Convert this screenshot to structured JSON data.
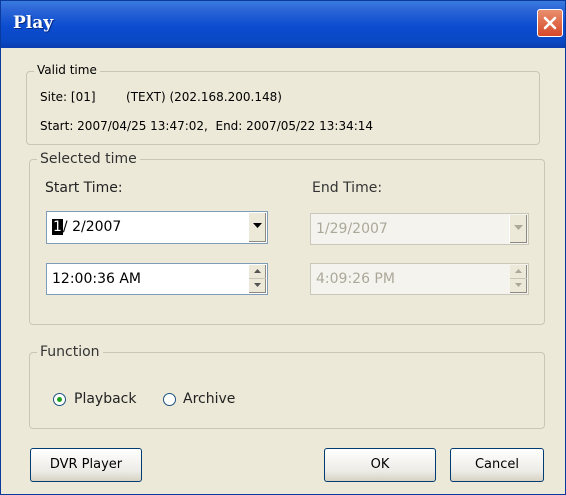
{
  "window": {
    "title": "Play"
  },
  "valid_time": {
    "legend": "Valid time",
    "site_line": "Site: [01]        (TEXT) (202.168.200.148)",
    "range_line": "Start: 2007/04/25 13:47:02,  End: 2007/05/22 13:34:14"
  },
  "selected_time": {
    "legend": "Selected time",
    "start_label": "Start Time:",
    "end_label": "End Time:",
    "start_date_cursor": "1",
    "start_date_rest": "/ 2/2007",
    "start_time": "12:00:36 AM",
    "end_date": "1/29/2007",
    "end_time": "4:09:26 PM"
  },
  "function": {
    "legend": "Function",
    "playback_label": "Playback",
    "archive_label": "Archive",
    "selected": "Playback"
  },
  "buttons": {
    "dvr_player": "DVR Player",
    "ok": "OK",
    "cancel": "Cancel"
  },
  "icons": {
    "close": "close-icon",
    "dropdown": "chevron-down-icon",
    "spinner": "spinner-icon"
  }
}
